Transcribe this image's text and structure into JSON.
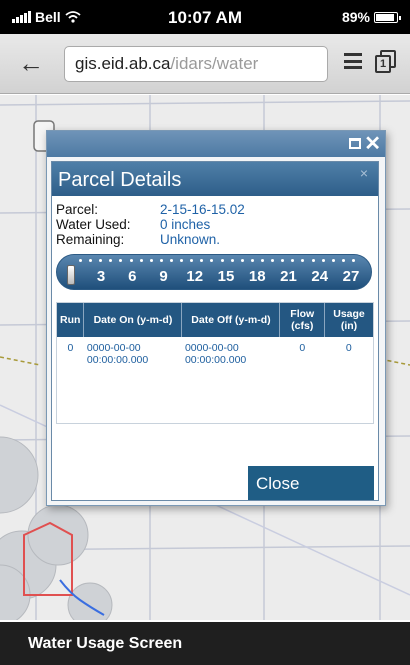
{
  "status_bar": {
    "carrier": "Bell",
    "time": "10:07 AM",
    "battery": "89%",
    "battery_level": 0.89
  },
  "browser": {
    "url_domain": "gis.eid.ab.ca",
    "url_path": "/idars/water",
    "tabs_count": "1"
  },
  "outer_dialog": {
    "close_glyph": "✕"
  },
  "parcel_panel": {
    "title": "Parcel Details",
    "dismiss_glyph": "×",
    "parcel_label": "Parcel:",
    "parcel_value": "2-15-16-15.02",
    "water_used_label": "Water Used:",
    "water_used_value": "0 inches",
    "remaining_label": "Remaining:",
    "remaining_value": "Unknown."
  },
  "slider": {
    "ticks": [
      "3",
      "6",
      "9",
      "12",
      "15",
      "18",
      "21",
      "24",
      "27"
    ],
    "value": 0
  },
  "table": {
    "headers": [
      "Run",
      "Date On (y-m-d)",
      "Date Off (y-m-d)",
      "Flow (cfs)",
      "Usage (in)"
    ],
    "rows": [
      [
        "0",
        "0000-00-00 00:00:00.000",
        "0000-00-00 00:00:00.000",
        "0",
        "0"
      ]
    ]
  },
  "close_button": "Close",
  "caption": "Water Usage Screen",
  "colors": {
    "header_blue": "#2e5e89",
    "link_blue": "#1f62a7",
    "button_blue": "#1f5d85"
  }
}
